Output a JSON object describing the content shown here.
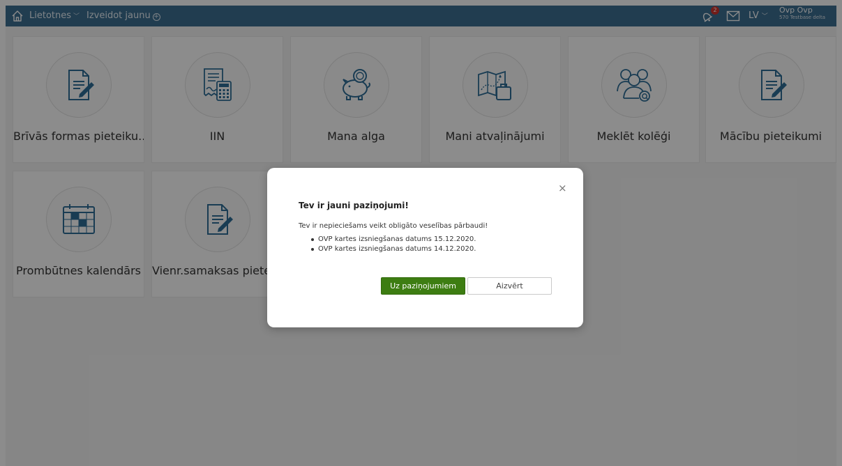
{
  "topbar": {
    "nav_apps": "Lietotnes",
    "nav_create": "Izveidot jaunu",
    "notification_count": "2",
    "language": "LV",
    "user_name": "Ovp Ovp",
    "user_sub": "570 Testbase delta",
    "icons": [
      "home-icon",
      "bell-icon",
      "mail-icon"
    ]
  },
  "tiles": [
    {
      "label": "Brīvās formas pieteiku...",
      "icon": "document-edit-icon"
    },
    {
      "label": "IIN",
      "icon": "receipt-calculator-icon"
    },
    {
      "label": "Mana alga",
      "icon": "piggy-bank-icon"
    },
    {
      "label": "Mani atvaļinājumi",
      "icon": "travel-map-suitcase-icon"
    },
    {
      "label": "Meklēt kolēģi",
      "icon": "people-search-icon"
    },
    {
      "label": "Mācību pieteikumi",
      "icon": "document-edit-icon"
    },
    {
      "label": "Prombūtnes kalendārs",
      "icon": "calendar-icon"
    },
    {
      "label": "Vienr.samaksas pieteikums",
      "icon": "document-edit-icon"
    }
  ],
  "modal": {
    "title": "Tev ir jauni paziņojumi!",
    "text": "Tev ir nepieciešams veikt obligāto veselības pārbaudi!",
    "items": [
      "OVP kartes izsniegšanas datums 15.12.2020.",
      "OVP kartes izsniegšanas datums 14.12.2020."
    ],
    "close_symbol": "×",
    "primary_button": "Uz paziņojumiem",
    "secondary_button": "Aizvērt"
  },
  "colors": {
    "topbar": "#3d6f93",
    "icon_blue": "#2f6e97",
    "primary_button": "#3d7d12",
    "badge": "#d0342c"
  }
}
